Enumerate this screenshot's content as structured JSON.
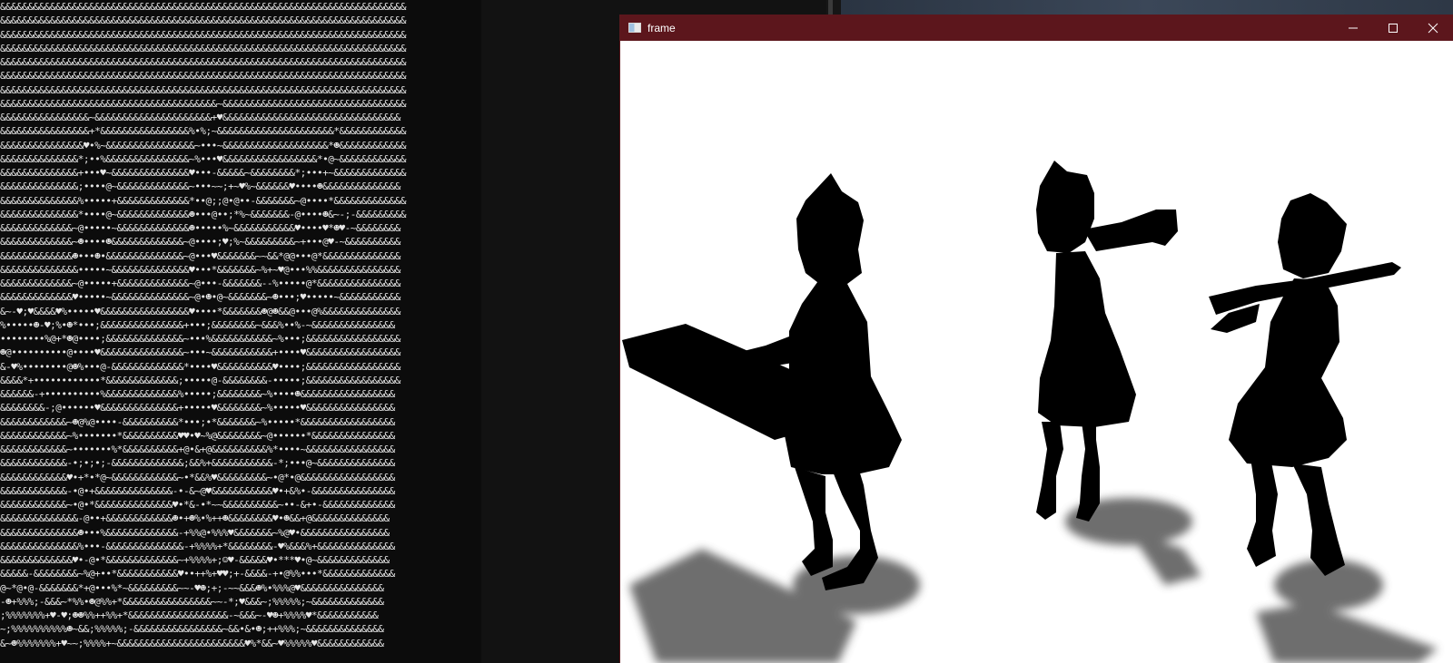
{
  "console": {
    "ascii_lines": [
      "&&&&&&&&&&&&&&&&&&&&&&&&&&&&&&&&&&&&&&&&&&&&&&&&&&&&&&&&&&&&&&&&&&&&&&&&&",
      "&&&&&&&&&&&&&&&&&&&&&&&&&&&&&&&&&&&&&&&&&&&&&&&&&&&&&&&&&&&&&&&&&&&&&&&&&",
      "&&&&&&&&&&&&&&&&&&&&&&&&&&&&&&&&&&&&&&&&&&&&&&&&&&&&&&&&&&&&&&&&&&&&&&&&&",
      "&&&&&&&&&&&&&&&&&&&&&&&&&&&&&&&&&&&&&&&&&&&&&&&&&&&&&&&&&&&&&&&&&&&&&&&&&",
      "&&&&&&&&&&&&&&&&&&&&&&&&&&&&&&&&&&&&&&&&&&&&&&&&&&&&&&&&&&&&&&&&&&&&&&&&&",
      "&&&&&&&&&&&&&&&&&&&&&&&&&&&&&&&&&&&&&&&&&&&&&&&&&&&&&&&&&&&&&&&&&&&&&&&&&",
      "&&&&&&&&&&&&&&&&&&&&&&&&&&&&&&&&&&&&&&&&&&&&&&&&&&&&&&&&&&&&&&&&&&&&&&&&&",
      "&&&&&&&&&&&&&&&&&&&&&&&&&&&&&&&&&&&&&&&~&&&&&&&&&&&&&&&&&&&&&&&&&&&&&&&&&",
      "&&&&&&&&&&&&&&&&~&&&&&&&&&&&&&&&&&&&&&+♥&&&&&&&&&&&&&&&&&&&&&&&&&&&&&&&&",
      "&&&&&&&&&&&&&&&&+*&&&&&&&&&&&&&&&&%•%;~&&&&&&&&&&&&&&&&&&&&&*&&&&&&&&&&&&",
      "&&&&&&&&&&&&&&&♥•%~&&&&&&&&&&&&&&&&~•••~&&&&&&&&&&&&&&&&&&&*☻&&&&&&&&&&&&",
      "&&&&&&&&&&&&&&*;••%&&&&&&&&&&&&&&&~%•••♥&&&&&&&&&&&&&&&&&*•@~&&&&&&&&&&&&",
      "&&&&&&&&&&&&&&+•••♥~&&&&&&&&&&&&&&♥•••-&&&&&~&&&&&&&&*;•••+~&&&&&&&&&&&&&",
      "&&&&&&&&&&&&&&;••••@~&&&&&&&&&&&&&~•••~~;+~♥%~&&&&&&♥••••☻&&&&&&&&&&&&&&",
      "&&&&&&&&&&&&&&%•••••+&&&&&&&&&&&&&*••@;;@•@••-&&&&&&&~@••••*&&&&&&&&&&&&&",
      "&&&&&&&&&&&&&&*••••@~&&&&&&&&&&&&&☻•••@••;*%~&&&&&&&-@••••☻&~-;-&&&&&&&&&",
      "&&&&&&&&&&&&&~@•••••~&&&&&&&&&&&&&☻•••••%~&&&&&&&&&&&♥••••♥*☻♥-~&&&&&&&&",
      "&&&&&&&&&&&&&~☻••••☻&&&&&&&&&&&&&~@••••;♥;%~&&&&&&&&&~+•••@♥-~&&&&&&&&&&",
      "&&&&&&&&&&&&&☻•••☻•&&&&&&&&&&&&&&~@•••♥&&&&&&&~~&&*@@•••@*&&&&&&&&&&&&&&",
      "&&&&&&&&&&&&&&•••••~&&&&&&&&&&&&&&♥•••*&&&&&&&~%+~♥@•••%%&&&&&&&&&&&&&&&",
      "&&&&&&&&&&&&&~@•••••+&&&&&&&&&&&&&~@•••-&&&&&&&--%•••••@*&&&&&&&&&&&&&&&",
      "&&&&&&&&&&&&&♥•••••~&&&&&&&&&&&&&&~@•☻•@~&&&&&&&~☻•••;♥•••••~&&&&&&&&&&&",
      "&~-♥;♥&&&&♥%•••••♥&&&&&&&&&&&&&&&&♥••••*&&&&&&&☻@☻&&@•••@%&&&&&&&&&&&&&&",
      "%•••••☻-♥;%•☻*•••;&&&&&&&&&&&&&&&+•••;&&&&&&&&~&&&%••%-~&&&&&&&&&&&&&&&",
      "••••••••%@+*☻@••••;&&&&&&&&&&&&&&~•••%&&&&&&&&&&&~%•••;&&&&&&&&&&&&&&&&&",
      "☻@••••••••••@••••♥&&&&&&&&&&&&&&&~•••~&&&&&&&&&&&+••••♥&&&&&&&&&&&&&&&&&",
      "&-♥%••••••••@☻%•••@-&&&&&&&&&&&&&*••••♥&&&&&&&&&&♥••••;&&&&&&&&&&&&&&&&&",
      "&&&&*+••••••••••••*&&&&&&&&&&&&&;•••••@-&&&&&&&&-•••••;&&&&&&&&&&&&&&&&&",
      "&&&&&&-+••••••••••%&&&&&&&&&&&&&%•••••;&&&&&&&&~%••••☻&&&&&&&&&&&&&&&&&",
      "&&&&&&&&-;@••••••♥&&&&&&&&&&&&&&+•••••♥&&&&&&&&~%•••••♥&&&&&&&&&&&&&&&&",
      "&&&&&&&&&&&&~☻@%@••••-&&&&&&&&&&*•••;•*&&&&&&&~%•••••*&&&&&&&&&&&&&&&&&",
      "&&&&&&&&&&&&~%•••••••*&&&&&&&&&&♥♥•♥~%@&&&&&&&&~@••••••*&&&&&&&&&&&&&&&",
      "&&&&&&&&&&&&~•••••••%*&&&&&&&&&&+@•&+@&&&&&&&&&&%*••••~&&&&&&&&&&&&&&&&",
      "&&&&&&&&&&&&-•;•;•;-&&&&&&&&&&&&&;&&%+&&&&&&&&&&&-*;•••@~&&&&&&&&&&&&&&",
      "&&&&&&&&&&&&♥•+*•*@~&&&&&&&&&&&&~•*&&%♥&&&&&&&&&~•@*•@&&&&&&&&&&&&&&&&&",
      "&&&&&&&&&&&&-•@•+&&&&&&&&&&&&&&-•-&~@♥&&&&&&&&&&&♥•+&%•-&&&&&&&&&&&&&&&",
      "&&&&&&&&&&&&~•@•*&&&&&&&&&&&&&&♥•*&-•*~~&&&&&&&&&&~••-&+•-&&&&&&&&&&&&&",
      "&&&&&&&&&&&&&&-@••+&&&&&&&&&&&&☻•+☻%•%++☻&&&&&&&&♥•☻&&+@&&&&&&&&&&&&&&",
      "&&&&&&&&&&&&&&☻•••%&&&&&&&&&&&&&-+%%@•%%%♥&&&&&&&~%@♥•&&&&&&&&&&&&&&&&",
      "&&&&&&&&&&&&&&%•••-&&&&&&&&&&&&&&-+%%%%+*&&&&&&&&-♥%&&&%+&&&&&&&&&&&&&&",
      "&&&&&&&&&&&&&♥•-@•*&&&&&&&&&&&&&~+%%%%+;☺♥-&&&&&♥•***♥•@~&&&&&&&&&&&&&",
      "&&&&&-&&&&&&&&~%@+••*&&&&&&&&&&&♥••++%+♥♥;+-&&&&-+•@%%•••*&&&&&&&&&&&&&",
      "@~*@•@-&&&&&&&*+@•••%*~&&&&&&&&&~~-♥☻;+;-~~&&&☻%•%%%@♥&&&&&&&&&&&&&&&",
      "-☻+%%%;-&&&~*%%•☻@%%+*&&&&&&&&&&&&&&&&~~-*;♥&&&~;%%%%%;~&&&&&&&&&&&&&",
      ";%%%%%%%+♥-♥;☻☻%%++%%+*&&&&&&&&&&&&&&&&&&-~&&&~-♥☻+%%%%♥*&&&&&&&&&&&",
      "~;%%%%%%%%%%☻~&&;%%%%%;-&&&&&&&&&&&&&&&&~&&•&•☻;++%%%;~&&&&&&&&&&&&&&",
      "&~☻%%%%%%%+♥~~;%%%%+~&&&&&&&&&&&&&&&&&&&&&&&♥%*&&~♥%%%%%♥&&&&&&&&&&&&"
    ]
  },
  "frame_window": {
    "title": "frame",
    "icon": "app-window-icon",
    "controls": [
      "minimize-icon",
      "maximize-icon",
      "close-icon"
    ]
  },
  "colors": {
    "titlebar": "#5c161c",
    "console_bg": "#0c0c0c",
    "console_text": "#e6e6e6",
    "silhouette": "#000000",
    "shadow": "#5a5a5a"
  }
}
